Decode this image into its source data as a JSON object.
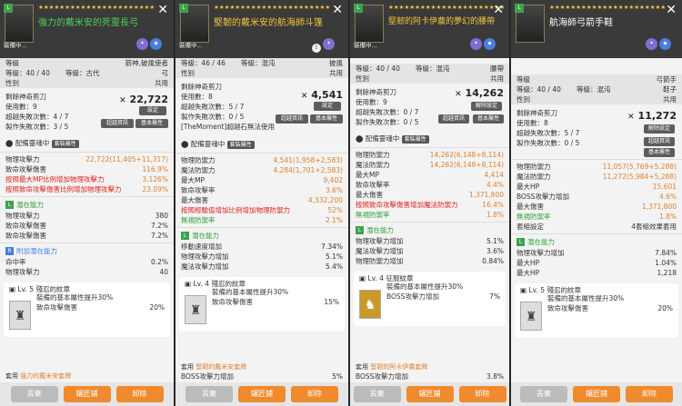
{
  "stars": "★★★★★★★★★★★★★★★★★★★★★★",
  "footer": {
    "left": "丟棄",
    "mid": "鑲匠鋪",
    "right": "卸除"
  },
  "card1": {
    "equip_tag": "裝備中...",
    "name": "強力的戴米安的死靈長弓",
    "level_label": "等級",
    "level_val": "箭神,破風使者",
    "lv_row": "等級：40 / 40",
    "class_label": "等級：古代",
    "class_val": "弓",
    "gender_label": "性別",
    "gender_val": "共用",
    "scissors": "剩餘神奇剪刀",
    "uses": "使用數：9",
    "fail": "超越失敗次數：4 / 7",
    "make": "製作失敗次數：3 / 5",
    "power": "22,722",
    "btn_set": "設定",
    "btn_info": "超越資訊",
    "btn_base": "基本屬性",
    "soul_label": "配備靈魂中",
    "soul_tag": "套裝屬性",
    "stats": [
      {
        "l": "物理攻擊力",
        "v": "22,722(11,405+11,317)",
        "c": "orange"
      },
      {
        "l": "致命攻擊傷害",
        "v": "116.9%",
        "c": "orange"
      },
      {
        "l": "按照最大MP比例增加物理攻擊力",
        "v": "3.126%",
        "c": "red"
      },
      {
        "l": "按照致命攻擊傷害比例增加物理攻擊力",
        "v": "23.09%",
        "c": "red"
      }
    ],
    "pot_title": "潛在能力",
    "pot": [
      {
        "l": "物理攻擊力",
        "v": "380"
      },
      {
        "l": "致命攻擊傷害",
        "v": "7.2%"
      },
      {
        "l": "致命攻擊傷害",
        "v": "7.2%"
      }
    ],
    "add_title": "附加潛在能力",
    "add": [
      {
        "l": "命中率",
        "v": "0.2%"
      },
      {
        "l": "物理攻擊力",
        "v": "40"
      }
    ],
    "soul_lv": "Lv. 5 殘忍的紋章",
    "soul_desc": "裝備的基本屬性提升30%",
    "soul_stat_l": "致命攻擊傷害",
    "soul_stat_v": "20%",
    "set_prefix": "套用",
    "set_name": "強力的戴米安套牌"
  },
  "card2": {
    "equip_tag": "裝備中...",
    "name": "堅韌的戴米安的航海師斗篷",
    "lv_row": "等級：46 / 46",
    "class_label": "等級：混沌",
    "class_val": "披風",
    "gender_label": "性別",
    "gender_val": "共用",
    "scissors": "剩餘神奇剪刀",
    "uses": "使用數：8",
    "fail": "超越失敗次數：5 / 7",
    "make": "製作失敗次數：0 / 5",
    "extra": "[TheMoment]超越石無法使用",
    "power": "4,541",
    "btn_set": "設定",
    "btn_info": "超越資訊",
    "btn_base": "基本屬性",
    "soul_label": "配備靈魂中",
    "soul_tag": "套裝屬性",
    "stats": [
      {
        "l": "物理防禦力",
        "v": "4,541(1,958+2,583)",
        "c": "orange"
      },
      {
        "l": "魔法防禦力",
        "v": "4,284(1,701+2,583)",
        "c": "orange"
      },
      {
        "l": "最大MP",
        "v": "9,402",
        "c": "orange"
      },
      {
        "l": "致命攻擊率",
        "v": "3.6%",
        "c": "orange"
      },
      {
        "l": "最大傷害",
        "v": "4,332,200",
        "c": "orange"
      },
      {
        "l": "按照經驗值增加比例增加物理防禦力",
        "v": "52%",
        "c": "red"
      },
      {
        "l": "無視防禦率",
        "v": "2.1%",
        "c": "green"
      }
    ],
    "pot_title": "潛在能力",
    "pot": [
      {
        "l": "移動速度增加",
        "v": "7.34%"
      },
      {
        "l": "物理攻擊力增加",
        "v": "5.1%"
      },
      {
        "l": "魔法攻擊力增加",
        "v": "5.4%"
      }
    ],
    "soul_lv": "Lv. 4 殘忍的紋章",
    "soul_desc": "裝備的基本屬性提升30%",
    "soul_stat_l": "致命攻擊傷害",
    "soul_stat_v": "15%",
    "set_prefix": "套用",
    "set_name": "堅韌的戴米安套牌",
    "set_stat_l": "BOSS攻擊力增加",
    "set_stat_v": "5%"
  },
  "card3": {
    "equip_tag": "裝備中...",
    "name": "堅韌的阿卡伊農的夢幻的腰帶",
    "lv_row": "等級：40 / 40",
    "class_label": "等級：混沌",
    "class_val": "腰帶",
    "gender_label": "性別",
    "gender_val": "共用",
    "scissors": "剩餘神奇剪刀",
    "uses": "使用數：9",
    "fail": "超越失敗次數：0 / 7",
    "make": "製作失敗次數：0 / 5",
    "power": "14,262",
    "btn_set": "解除設定",
    "btn_info": "超越資訊",
    "btn_base": "基本屬性",
    "soul_label": "配備靈魂中",
    "soul_tag": "套裝屬性",
    "stats": [
      {
        "l": "物理防禦力",
        "v": "14,262(6,148+8,114)",
        "c": "orange"
      },
      {
        "l": "魔法防禦力",
        "v": "14,262(6,148+8,114)",
        "c": "orange"
      },
      {
        "l": "最大MP",
        "v": "4,414",
        "c": "orange"
      },
      {
        "l": "致命攻擊率",
        "v": "4.4%",
        "c": "orange"
      },
      {
        "l": "最大傷害",
        "v": "1,371,800",
        "c": "orange"
      },
      {
        "l": "按照致命攻擊傷害增加魔法防禦力",
        "v": "16.4%",
        "c": "red"
      },
      {
        "l": "無視防禦率",
        "v": "1.8%",
        "c": "green"
      }
    ],
    "pot_title": "潛在能力",
    "pot": [
      {
        "l": "物理攻擊力增加",
        "v": "5.1%"
      },
      {
        "l": "魔法攻擊力增加",
        "v": "3.6%"
      },
      {
        "l": "物理防禦力增加",
        "v": "0.84%"
      }
    ],
    "soul_lv": "Lv. 4 征服紋章",
    "soul_desc": "裝備的基本屬性提升30%",
    "soul_stat_l": "BOSS攻擊力增加",
    "soul_stat_v": "7%",
    "set_prefix": "套用",
    "set_name": "堅韌的阿卡伊農套牌",
    "set_stat_l": "BOSS攻擊力增加",
    "set_stat_v": "3.8%"
  },
  "card4": {
    "name": "航海師弓箭手鞋",
    "level_label": "等級",
    "level_val": "弓箭手",
    "lv_row": "等級：40 / 40",
    "class_label": "等級：混沌",
    "class_val": "鞋子",
    "gender_label": "性別",
    "gender_val": "共用",
    "scissors": "剩餘神奇剪刀",
    "uses": "使用數：8",
    "fail": "超越失敗次數：5 / 7",
    "make": "製作失敗次數：0 / 5",
    "power": "11,272",
    "btn_set": "解除設定",
    "btn_info": "超越資訊",
    "btn_base": "基本屬性",
    "stats": [
      {
        "l": "物理防禦力",
        "v": "11,057(5,769+5,288)",
        "c": "orange"
      },
      {
        "l": "魔法防禦力",
        "v": "11,272(5,984+5,288)",
        "c": "orange"
      },
      {
        "l": "最大HP",
        "v": "15,601",
        "c": "orange"
      },
      {
        "l": "BOSS攻擊力增加",
        "v": "4.6%",
        "c": "orange"
      },
      {
        "l": "最大傷害",
        "v": "1,371,800",
        "c": "orange"
      },
      {
        "l": "無視防禦率",
        "v": "1.8%",
        "c": "green"
      },
      {
        "l": "套組設定",
        "v": "4套組效果套用",
        "c": ""
      }
    ],
    "pot_title": "潛在能力",
    "pot": [
      {
        "l": "物理攻擊力增加",
        "v": "7.84%"
      },
      {
        "l": "最大HP",
        "v": "1.04%"
      },
      {
        "l": "最大HP",
        "v": "1,218"
      }
    ],
    "soul_lv": "Lv. 5 殘忍的紋章",
    "soul_desc": "裝備的基本屬性提升30%",
    "soul_stat_l": "致命攻擊傷害",
    "soul_stat_v": "20%"
  }
}
